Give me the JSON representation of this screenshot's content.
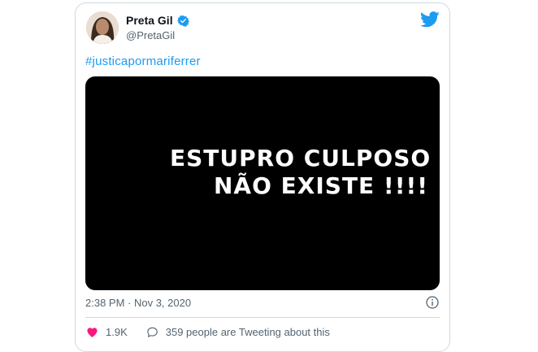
{
  "user": {
    "display_name": "Preta Gil",
    "handle": "@PretaGil"
  },
  "tweet": {
    "hashtag": "#justicapormariferrer",
    "media_text": {
      "line1": "ESTUPRO CULPOSO",
      "line2": "NÃO EXISTE !!!!"
    },
    "timestamp": "2:38 PM · Nov 3, 2020"
  },
  "actions": {
    "likes": "1.9K",
    "conversation": "359 people are Tweeting about this"
  },
  "colors": {
    "accent": "#1d9bf0",
    "like": "#f91880",
    "media_bg": "#000000"
  },
  "icons": {
    "verified": "verified-badge-icon",
    "bird": "twitter-bird-icon",
    "info": "info-icon",
    "like": "heart-icon",
    "conversation": "speech-bubble-icon"
  }
}
